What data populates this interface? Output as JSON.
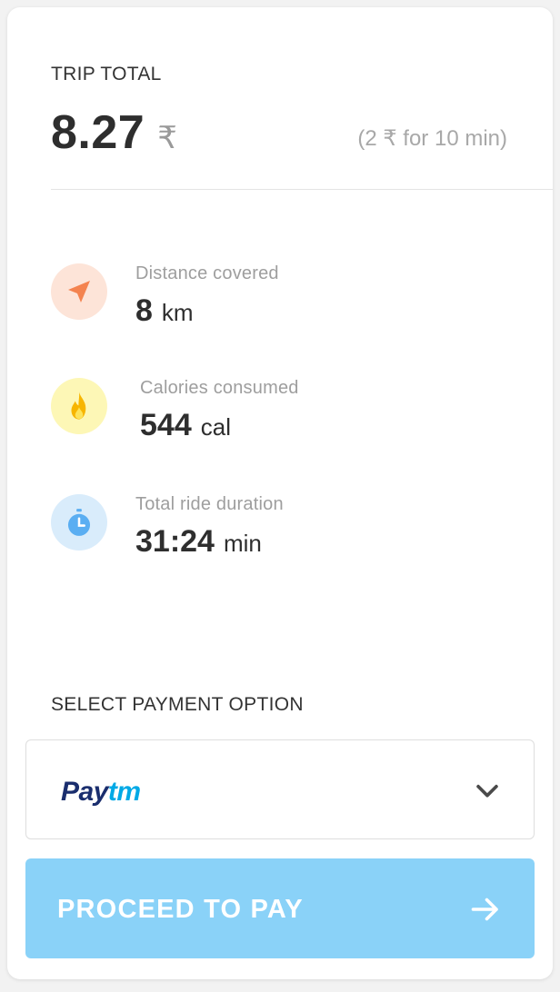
{
  "trip": {
    "label": "TRIP TOTAL",
    "amount": "8.27",
    "currency": "₹",
    "rate": "(2 ₹ for 10 min)"
  },
  "stats": [
    {
      "caption": "Distance covered",
      "value": "8",
      "unit": "km",
      "icon": "navigation-arrow-icon",
      "icon_color": "#f4834f",
      "circle_color": "#fde4d8"
    },
    {
      "caption": "Calories consumed",
      "value": "544",
      "unit": "cal",
      "icon": "flame-icon",
      "icon_color": "#f7b500",
      "circle_color": "#fdf7b6"
    },
    {
      "caption": "Total ride duration",
      "value": "31:24",
      "unit": "min",
      "icon": "stopwatch-icon",
      "icon_color": "#5aaef2",
      "circle_color": "#d9ecfb"
    }
  ],
  "payment": {
    "label": "SELECT PAYMENT OPTION",
    "selected_brand_part1": "Pay",
    "selected_brand_part2": "tm"
  },
  "proceed": {
    "label": "PROCEED TO PAY"
  },
  "colors": {
    "accent": "#8ad2f8",
    "paytm_dark": "#1a2e6e",
    "paytm_light": "#00a9e6"
  }
}
